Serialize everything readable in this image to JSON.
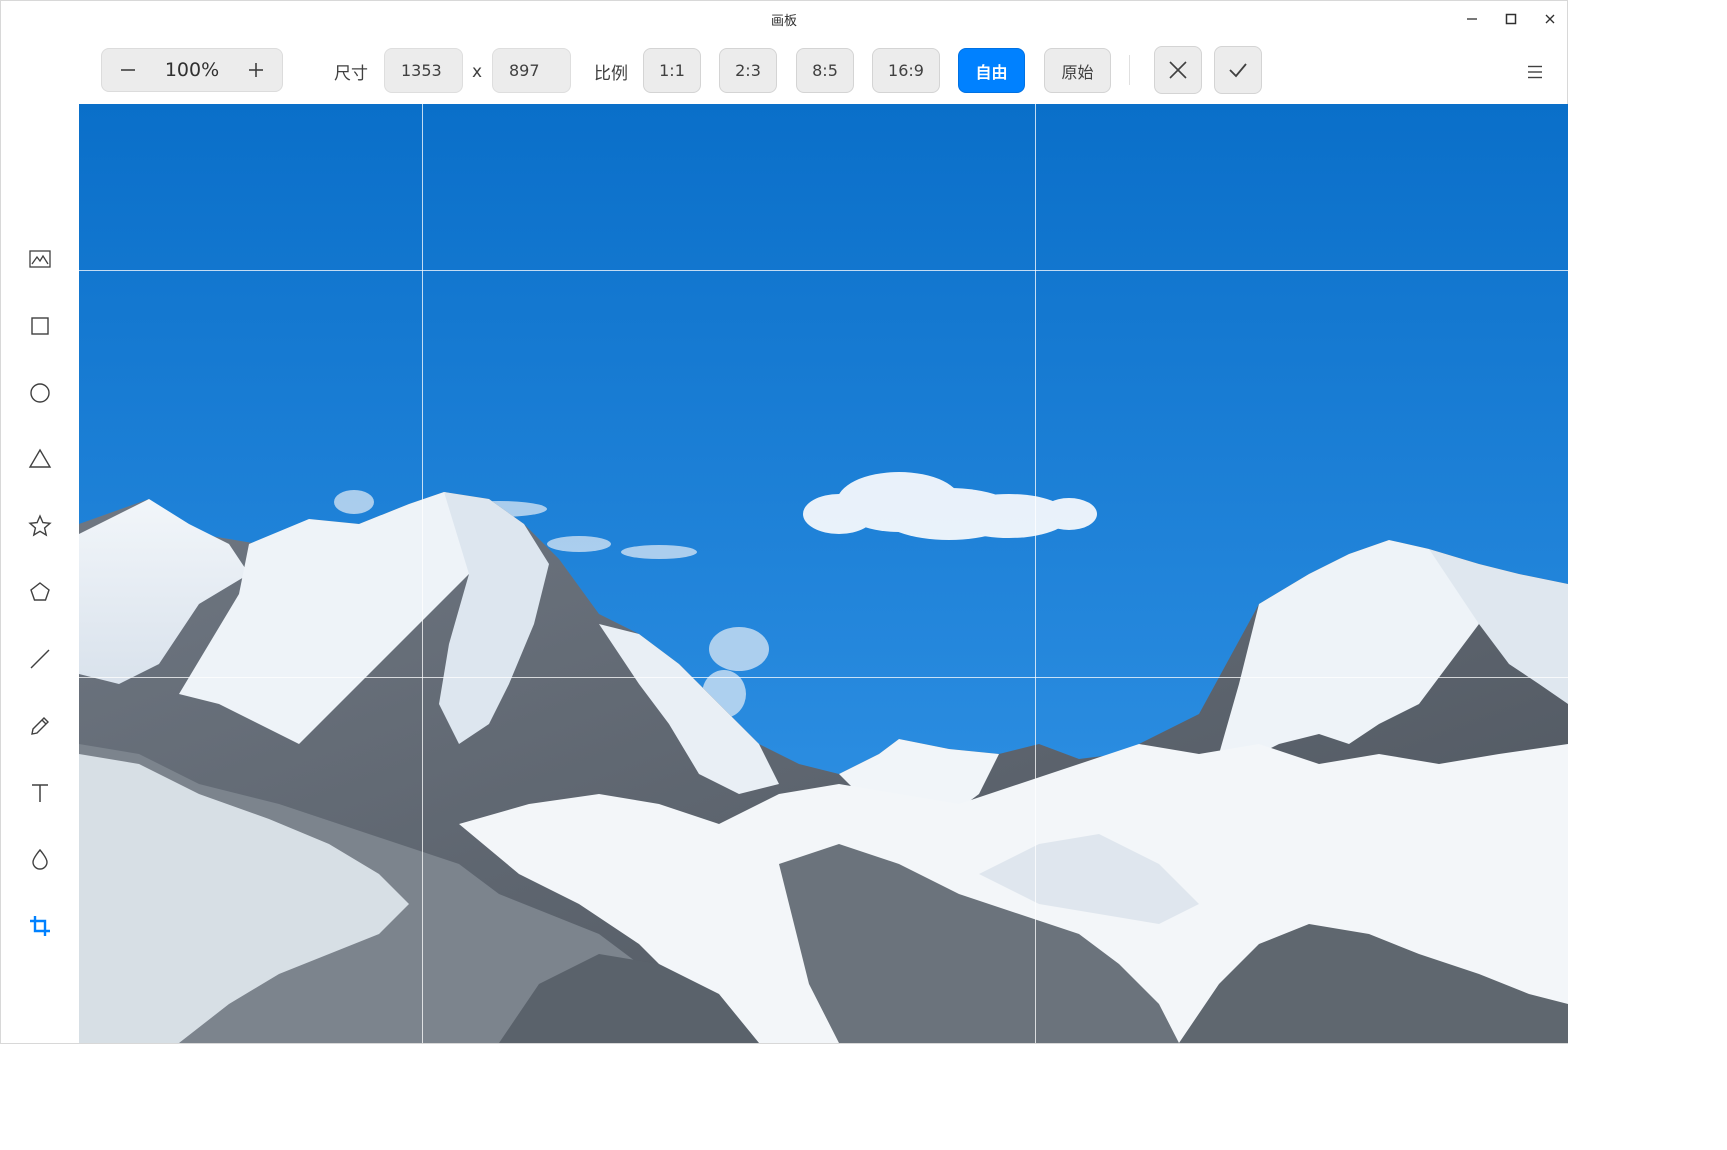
{
  "window": {
    "title": "画板"
  },
  "toolbar": {
    "zoom": {
      "value": "100%",
      "decrease_icon": "minus-icon",
      "increase_icon": "plus-icon"
    },
    "size": {
      "label": "尺寸",
      "width": "1353",
      "separator": "x",
      "height": "897"
    },
    "ratio": {
      "label": "比例",
      "options": [
        "1:1",
        "2:3",
        "8:5",
        "16:9",
        "自由",
        "原始"
      ],
      "selected": "自由"
    },
    "cancel_icon": "close-icon",
    "confirm_icon": "check-icon",
    "menu_icon": "menu-icon"
  },
  "tools": [
    {
      "name": "image",
      "icon": "image-icon"
    },
    {
      "name": "rectangle",
      "icon": "rectangle-icon"
    },
    {
      "name": "ellipse",
      "icon": "circle-icon"
    },
    {
      "name": "triangle",
      "icon": "triangle-icon"
    },
    {
      "name": "star",
      "icon": "star-icon"
    },
    {
      "name": "polygon",
      "icon": "pentagon-icon"
    },
    {
      "name": "line",
      "icon": "line-icon"
    },
    {
      "name": "pencil",
      "icon": "pencil-icon"
    },
    {
      "name": "text",
      "icon": "text-icon"
    },
    {
      "name": "blur",
      "icon": "drop-icon"
    },
    {
      "name": "crop",
      "icon": "crop-icon",
      "active": true
    }
  ],
  "colors": {
    "accent": "#0081ff",
    "sky_top": "#0a6fc9",
    "sky_bottom": "#2a8ce0"
  }
}
